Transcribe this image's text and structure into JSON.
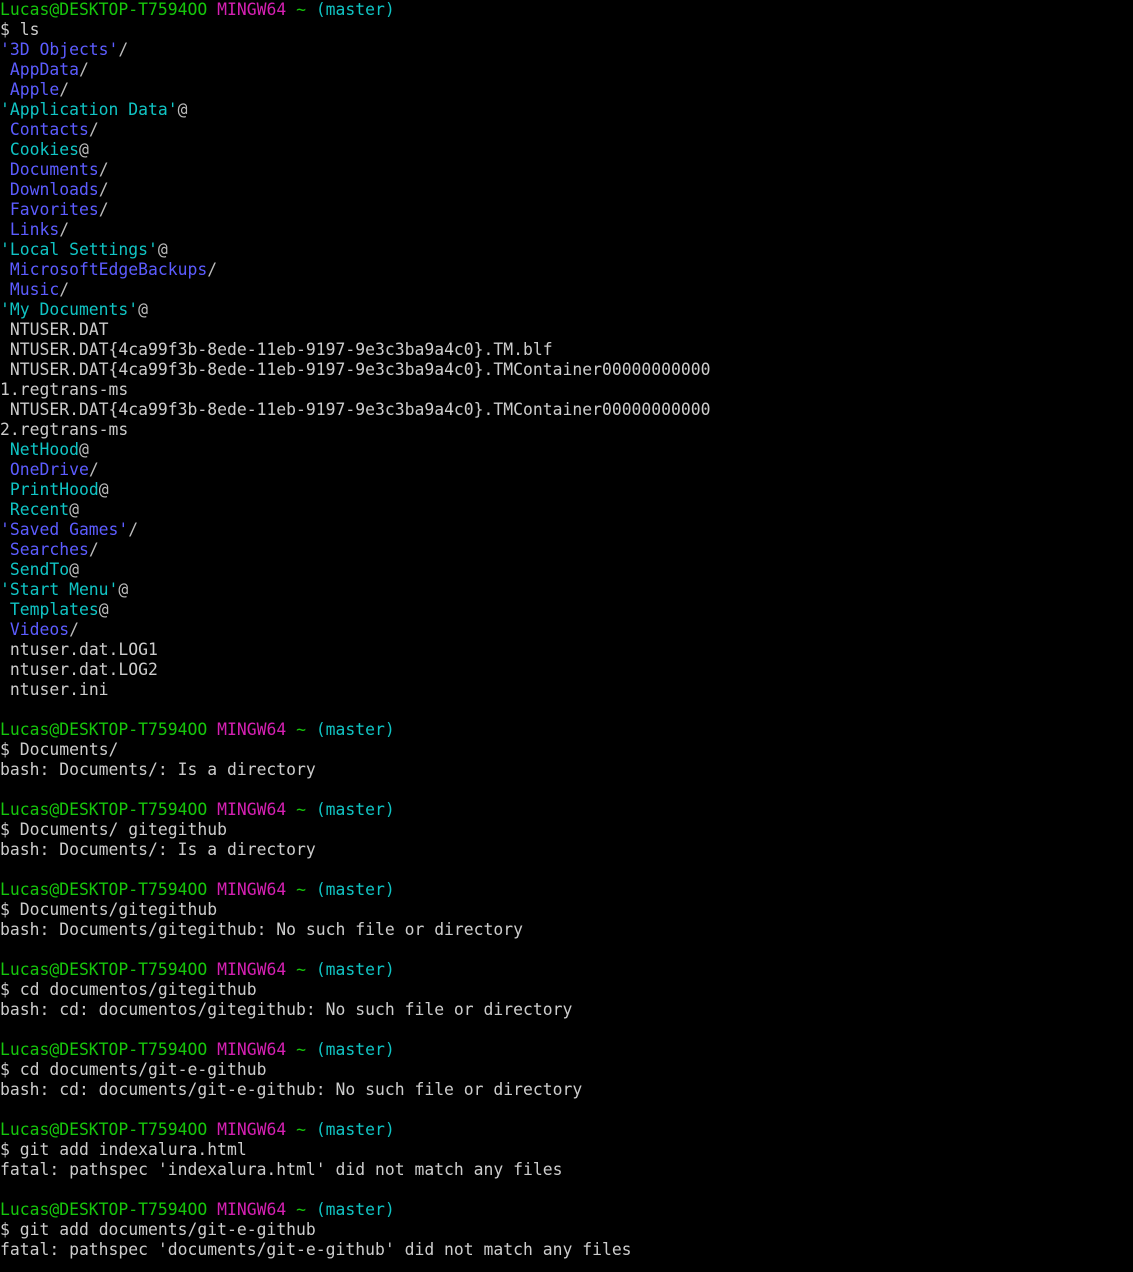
{
  "terminal": {
    "app": "MINGW64",
    "font_size_px": 16.4,
    "line_height_px": 20,
    "background": "#000000",
    "foreground": "#cccccc",
    "colors": {
      "user_host": "#16c60c",
      "shell_label": "#d520b2",
      "branch": "#10c4c4",
      "directory": "#5c5cff",
      "symlink": "#10c4c4",
      "file": "#cccccc",
      "marker": "#bbbbbb"
    },
    "prompt": {
      "user_host": "Lucas@DESKTOP-T7594OO",
      "shell": "MINGW64",
      "path": "~",
      "branch": "(master)",
      "sigil": "$"
    }
  },
  "lines": [
    {
      "type": "prompt"
    },
    {
      "type": "command",
      "text": "ls"
    },
    {
      "type": "entry",
      "name": "'3D Objects'",
      "kind": "dir",
      "marker": "/",
      "indent": false
    },
    {
      "type": "entry",
      "name": "AppData",
      "kind": "dir",
      "marker": "/",
      "indent": true
    },
    {
      "type": "entry",
      "name": "Apple",
      "kind": "dir",
      "marker": "/",
      "indent": true
    },
    {
      "type": "entry",
      "name": "'Application Data'",
      "kind": "link",
      "marker": "@",
      "indent": false
    },
    {
      "type": "entry",
      "name": "Contacts",
      "kind": "dir",
      "marker": "/",
      "indent": true
    },
    {
      "type": "entry",
      "name": "Cookies",
      "kind": "link",
      "marker": "@",
      "indent": true
    },
    {
      "type": "entry",
      "name": "Documents",
      "kind": "dir",
      "marker": "/",
      "indent": true
    },
    {
      "type": "entry",
      "name": "Downloads",
      "kind": "dir",
      "marker": "/",
      "indent": true
    },
    {
      "type": "entry",
      "name": "Favorites",
      "kind": "dir",
      "marker": "/",
      "indent": true
    },
    {
      "type": "entry",
      "name": "Links",
      "kind": "dir",
      "marker": "/",
      "indent": true
    },
    {
      "type": "entry",
      "name": "'Local Settings'",
      "kind": "link",
      "marker": "@",
      "indent": false
    },
    {
      "type": "entry",
      "name": "MicrosoftEdgeBackups",
      "kind": "dir",
      "marker": "/",
      "indent": true
    },
    {
      "type": "entry",
      "name": "Music",
      "kind": "dir",
      "marker": "/",
      "indent": true
    },
    {
      "type": "entry",
      "name": "'My Documents'",
      "kind": "link",
      "marker": "@",
      "indent": false
    },
    {
      "type": "entry",
      "name": "NTUSER.DAT",
      "kind": "file",
      "marker": "",
      "indent": true
    },
    {
      "type": "entry",
      "name": "NTUSER.DAT{4ca99f3b-8ede-11eb-9197-9e3c3ba9a4c0}.TM.blf",
      "kind": "file",
      "marker": "",
      "indent": true
    },
    {
      "type": "entry",
      "name": "NTUSER.DAT{4ca99f3b-8ede-11eb-9197-9e3c3ba9a4c0}.TMContainer00000000000",
      "kind": "file",
      "marker": "",
      "indent": true
    },
    {
      "type": "entry",
      "name": "1.regtrans-ms",
      "kind": "file",
      "marker": "",
      "indent": false
    },
    {
      "type": "entry",
      "name": "NTUSER.DAT{4ca99f3b-8ede-11eb-9197-9e3c3ba9a4c0}.TMContainer00000000000",
      "kind": "file",
      "marker": "",
      "indent": true
    },
    {
      "type": "entry",
      "name": "2.regtrans-ms",
      "kind": "file",
      "marker": "",
      "indent": false
    },
    {
      "type": "entry",
      "name": "NetHood",
      "kind": "link",
      "marker": "@",
      "indent": true
    },
    {
      "type": "entry",
      "name": "OneDrive",
      "kind": "dir",
      "marker": "/",
      "indent": true
    },
    {
      "type": "entry",
      "name": "PrintHood",
      "kind": "link",
      "marker": "@",
      "indent": true
    },
    {
      "type": "entry",
      "name": "Recent",
      "kind": "link",
      "marker": "@",
      "indent": true
    },
    {
      "type": "entry",
      "name": "'Saved Games'",
      "kind": "dir",
      "marker": "/",
      "indent": false
    },
    {
      "type": "entry",
      "name": "Searches",
      "kind": "dir",
      "marker": "/",
      "indent": true
    },
    {
      "type": "entry",
      "name": "SendTo",
      "kind": "link",
      "marker": "@",
      "indent": true
    },
    {
      "type": "entry",
      "name": "'Start Menu'",
      "kind": "link",
      "marker": "@",
      "indent": false
    },
    {
      "type": "entry",
      "name": "Templates",
      "kind": "link",
      "marker": "@",
      "indent": true
    },
    {
      "type": "entry",
      "name": "Videos",
      "kind": "dir",
      "marker": "/",
      "indent": true
    },
    {
      "type": "entry",
      "name": "ntuser.dat.LOG1",
      "kind": "file",
      "marker": "",
      "indent": true
    },
    {
      "type": "entry",
      "name": "ntuser.dat.LOG2",
      "kind": "file",
      "marker": "",
      "indent": true
    },
    {
      "type": "entry",
      "name": "ntuser.ini",
      "kind": "file",
      "marker": "",
      "indent": true
    },
    {
      "type": "blank"
    },
    {
      "type": "prompt"
    },
    {
      "type": "command",
      "text": "Documents/"
    },
    {
      "type": "output",
      "text": "bash: Documents/: Is a directory"
    },
    {
      "type": "blank"
    },
    {
      "type": "prompt"
    },
    {
      "type": "command",
      "text": "Documents/ gitegithub"
    },
    {
      "type": "output",
      "text": "bash: Documents/: Is a directory"
    },
    {
      "type": "blank"
    },
    {
      "type": "prompt"
    },
    {
      "type": "command",
      "text": "Documents/gitegithub"
    },
    {
      "type": "output",
      "text": "bash: Documents/gitegithub: No such file or directory"
    },
    {
      "type": "blank"
    },
    {
      "type": "prompt"
    },
    {
      "type": "command",
      "text": "cd documentos/gitegithub"
    },
    {
      "type": "output",
      "text": "bash: cd: documentos/gitegithub: No such file or directory"
    },
    {
      "type": "blank"
    },
    {
      "type": "prompt"
    },
    {
      "type": "command",
      "text": "cd documents/git-e-github"
    },
    {
      "type": "output",
      "text": "bash: cd: documents/git-e-github: No such file or directory"
    },
    {
      "type": "blank"
    },
    {
      "type": "prompt"
    },
    {
      "type": "command",
      "text": "git add indexalura.html"
    },
    {
      "type": "output",
      "text": "fatal: pathspec 'indexalura.html' did not match any files"
    },
    {
      "type": "blank"
    },
    {
      "type": "prompt"
    },
    {
      "type": "command",
      "text": "git add documents/git-e-github"
    },
    {
      "type": "output",
      "text": "fatal: pathspec 'documents/git-e-github' did not match any files"
    }
  ]
}
